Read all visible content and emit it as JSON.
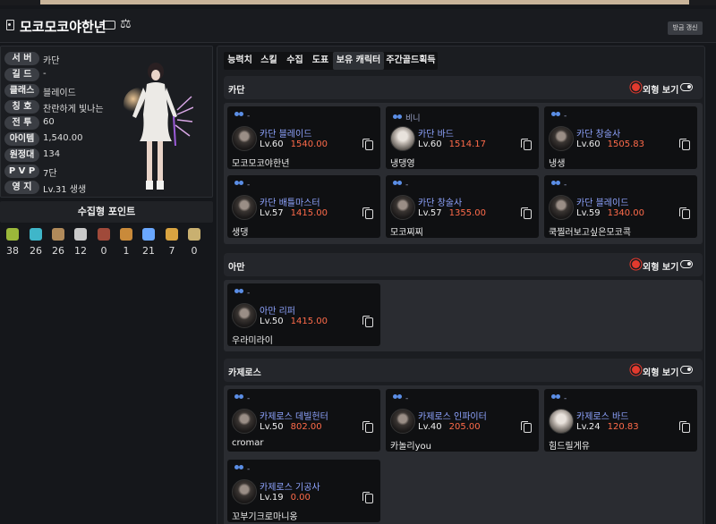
{
  "header": {
    "character_name": "모코모코야한년",
    "refresh_label": "방금 갱신"
  },
  "profile": {
    "rows": [
      {
        "label": "서 버",
        "value": "카단"
      },
      {
        "label": "길 드",
        "value": "-"
      },
      {
        "label": "클래스",
        "value": "블레이드"
      },
      {
        "label": "칭 호",
        "value": "찬란하게 빛나는"
      },
      {
        "label": "전 투",
        "value": "60"
      },
      {
        "label": "아이템",
        "value": "1,540.00"
      },
      {
        "label": "원정대",
        "value": "134"
      },
      {
        "label": "P V P",
        "value": "7단"
      },
      {
        "label": "영 지",
        "value": "Lv.31 생생"
      }
    ]
  },
  "collection": {
    "title": "수집형 포인트",
    "items": [
      {
        "icon": "mokoko-seed-icon",
        "count": "38",
        "color": "#9bb83a"
      },
      {
        "icon": "island-heart-icon",
        "count": "26",
        "color": "#3fb6c9"
      },
      {
        "icon": "giant-heart-icon",
        "count": "26",
        "color": "#b08a5a"
      },
      {
        "icon": "ignea-token-icon",
        "count": "12",
        "color": "#c9c9c9"
      },
      {
        "icon": "art-icon",
        "count": "0",
        "color": "#a04a3a"
      },
      {
        "icon": "voyage-icon",
        "count": "1",
        "color": "#c98a3a"
      },
      {
        "icon": "star-icon",
        "count": "21",
        "color": "#6aa8ff"
      },
      {
        "icon": "leaf-icon",
        "count": "7",
        "color": "#d9a441"
      },
      {
        "icon": "orpheus-star-icon",
        "count": "0",
        "color": "#c9b070"
      }
    ]
  },
  "tabs": [
    "능력치",
    "스킬",
    "수집",
    "도표",
    "보유 캐릭터",
    "주간골드획득"
  ],
  "active_tab": "보유 캐릭터",
  "view_label": "외형 보기",
  "servers": [
    {
      "name": "카단",
      "characters": [
        {
          "guild": "-",
          "server": "카단",
          "class": "블레이드",
          "level": "Lv.60",
          "item_level": "1540.00",
          "name": "모코모코야한년",
          "portrait": "dark"
        },
        {
          "guild": "비니",
          "server": "카단",
          "class": "바드",
          "level": "Lv.60",
          "item_level": "1514.17",
          "name": "냉댕영",
          "portrait": "light"
        },
        {
          "guild": "-",
          "server": "카단",
          "class": "창술사",
          "level": "Lv.60",
          "item_level": "1505.83",
          "name": "냉생",
          "portrait": "dark"
        },
        {
          "guild": "-",
          "server": "카단",
          "class": "배틀마스터",
          "level": "Lv.57",
          "item_level": "1415.00",
          "name": "생댕",
          "portrait": "dark"
        },
        {
          "guild": "-",
          "server": "카단",
          "class": "창술사",
          "level": "Lv.57",
          "item_level": "1355.00",
          "name": "모코찌찌",
          "portrait": "dark"
        },
        {
          "guild": "-",
          "server": "카단",
          "class": "블레이드",
          "level": "Lv.59",
          "item_level": "1340.00",
          "name": "쿡찔러보고싶은모코콕",
          "portrait": "dark"
        }
      ]
    },
    {
      "name": "아만",
      "characters": [
        {
          "guild": "-",
          "server": "아만",
          "class": "리퍼",
          "level": "Lv.50",
          "item_level": "1415.00",
          "name": "우라미라이",
          "portrait": "dark"
        }
      ]
    },
    {
      "name": "카제로스",
      "characters": [
        {
          "guild": "-",
          "server": "카제로스",
          "class": "데빌헌터",
          "level": "Lv.50",
          "item_level": "802.00",
          "name": "cromar",
          "portrait": "dark"
        },
        {
          "guild": "-",
          "server": "카제로스",
          "class": "인파이터",
          "level": "Lv.40",
          "item_level": "205.00",
          "name": "카놀리you",
          "portrait": "dark"
        },
        {
          "guild": "-",
          "server": "카제로스",
          "class": "바드",
          "level": "Lv.24",
          "item_level": "120.83",
          "name": "힘드릴게유",
          "portrait": "light"
        },
        {
          "guild": "-",
          "server": "카제로스",
          "class": "기공사",
          "level": "Lv.19",
          "item_level": "0.00",
          "name": "꼬부기크로마니옹",
          "portrait": "dark"
        }
      ]
    }
  ]
}
